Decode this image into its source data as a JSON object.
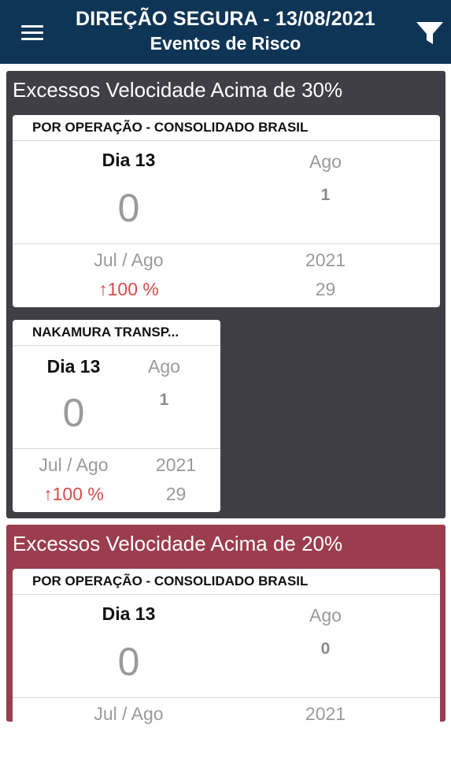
{
  "header": {
    "title": "DIREÇÃO SEGURA - 13/08/2021",
    "subtitle": "Eventos de Risco",
    "menu_icon": "menu-icon",
    "filter_icon": "filter-icon",
    "color": "#0f3556"
  },
  "sections": [
    {
      "title": "Excessos Velocidade Acima de 30%",
      "color": "#3f3f45",
      "cards": [
        {
          "heading": "POR OPERAÇÃO - CONSOLIDADO BRASIL",
          "day_label": "Dia 13",
          "day_value": "0",
          "month_label": "Ago",
          "month_value": "1",
          "period_label": "Jul / Ago",
          "period_change": "↑100 %",
          "year_label": "2021",
          "year_value": "29"
        },
        {
          "heading": "NAKAMURA TRANSP...",
          "day_label": "Dia 13",
          "day_value": "0",
          "month_label": "Ago",
          "month_value": "1",
          "period_label": "Jul / Ago",
          "period_change": "↑100 %",
          "year_label": "2021",
          "year_value": "29"
        }
      ]
    },
    {
      "title": "Excessos Velocidade Acima de 20%",
      "color": "#9b3d4e",
      "cards": [
        {
          "heading": "POR OPERAÇÃO - CONSOLIDADO BRASIL",
          "day_label": "Dia 13",
          "day_value": "0",
          "month_label": "Ago",
          "month_value": "0",
          "period_label": "Jul / Ago",
          "year_label": "2021"
        }
      ]
    }
  ]
}
